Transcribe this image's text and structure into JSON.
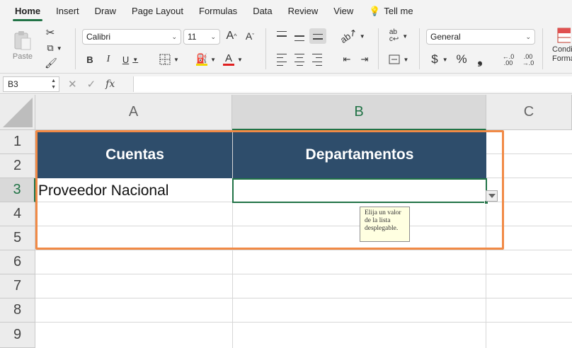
{
  "ribbon_tabs": [
    {
      "label": "Home",
      "active": true
    },
    {
      "label": "Insert"
    },
    {
      "label": "Draw"
    },
    {
      "label": "Page Layout"
    },
    {
      "label": "Formulas"
    },
    {
      "label": "Data"
    },
    {
      "label": "Review"
    },
    {
      "label": "View"
    },
    {
      "label": "Tell me"
    }
  ],
  "clipboard": {
    "paste_label": "Paste"
  },
  "font": {
    "name": "Calibri",
    "size": "11",
    "increase_label": "A",
    "decrease_label": "A",
    "bold": "B",
    "italic": "I",
    "underline": "U",
    "color_label": "A"
  },
  "number": {
    "format": "General",
    "currency": "$",
    "percent": "%",
    "comma": "❟",
    "inc_decimals": "←.0\n.00",
    "dec_decimals": ".00\n→.0"
  },
  "styles": {
    "conditional_label_line1": "Condi",
    "conditional_label_line2": "Forma"
  },
  "formula_bar": {
    "name_box": "B3",
    "cancel": "✕",
    "enter": "✓",
    "fx": "fx",
    "value": ""
  },
  "columns": [
    "A",
    "B",
    "C"
  ],
  "rows": [
    "1",
    "2",
    "3",
    "4",
    "5",
    "6",
    "7",
    "8",
    "9"
  ],
  "cells": {
    "header_a": "Cuentas",
    "header_b": "Departamentos",
    "A3": "Proveedor Nacional",
    "B3": ""
  },
  "validation_tooltip": "Elija un valor\nde la lista\ndesplegable.",
  "colors": {
    "header_fill": "#2e4d6b",
    "accent_green": "#217346",
    "highlight_border": "#f18a46"
  }
}
